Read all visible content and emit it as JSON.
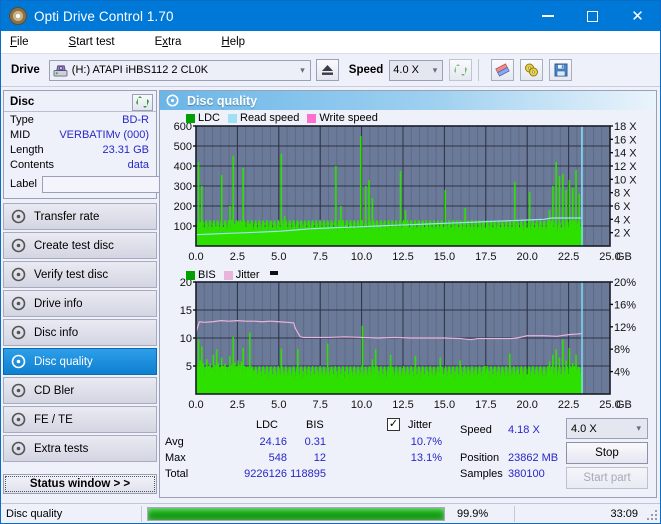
{
  "window": {
    "title": "Opti Drive Control 1.70",
    "icon": "disc-icon",
    "minimize": "−",
    "maximize": "□",
    "close": "✕"
  },
  "menu": [
    {
      "label": "File",
      "accel": "F"
    },
    {
      "label": "Start test",
      "accel": "S"
    },
    {
      "label": "Extra",
      "accel": "x"
    },
    {
      "label": "Help",
      "accel": "H"
    }
  ],
  "toolbar": {
    "drive_label": "Drive",
    "drive_value": "(H:) ATAPI iHBS112  2 CL0K",
    "eject_icon": "eject-icon",
    "speed_label": "Speed",
    "speed_value": "4.0 X",
    "refresh_icon": "refresh-icon",
    "erase_icon": "erase-icon",
    "disc-tools_icon": "disc-tools-icon",
    "save_icon": "save-icon"
  },
  "sidebar": {
    "disc_panel": {
      "title": "Disc",
      "refresh_icon": "refresh-green-icon",
      "rows": [
        {
          "key": "Type",
          "value": "BD-R"
        },
        {
          "key": "MID",
          "value": "VERBATIMv (000)"
        },
        {
          "key": "Length",
          "value": "23.31 GB"
        },
        {
          "key": "Contents",
          "value": "data"
        }
      ],
      "label_key": "Label",
      "label_value": "",
      "label_placeholder": "",
      "label_button_icon": "disc-yellow-icon"
    },
    "nav": [
      {
        "label": "Transfer rate",
        "icon": "disc-icon",
        "selected": false
      },
      {
        "label": "Create test disc",
        "icon": "disc-icon",
        "selected": false
      },
      {
        "label": "Verify test disc",
        "icon": "disc-icon",
        "selected": false
      },
      {
        "label": "Drive info",
        "icon": "disc-icon",
        "selected": false
      },
      {
        "label": "Disc info",
        "icon": "disc-icon",
        "selected": false
      },
      {
        "label": "Disc quality",
        "icon": "disc-icon",
        "selected": true
      },
      {
        "label": "CD Bler",
        "icon": "disc-icon",
        "selected": false
      },
      {
        "label": "FE / TE",
        "icon": "disc-icon",
        "selected": false
      },
      {
        "label": "Extra tests",
        "icon": "disc-icon",
        "selected": false
      }
    ],
    "status_window_button": "Status window > >"
  },
  "panel": {
    "title": "Disc quality",
    "icon": "disc-icon"
  },
  "stats": {
    "col_ldc": "LDC",
    "col_bis": "BIS",
    "jitter_label": "Jitter",
    "jitter_checked": true,
    "rows": [
      {
        "name": "Avg",
        "ldc": "24.16",
        "bis": "0.31",
        "jitter": "10.7%"
      },
      {
        "name": "Max",
        "ldc": "548",
        "bis": "12",
        "jitter": "13.1%"
      },
      {
        "name": "Total",
        "ldc": "9226126",
        "bis": "118895",
        "jitter": ""
      }
    ],
    "speed_key": "Speed",
    "speed_value": "4.18 X",
    "position_key": "Position",
    "position_value": "23862 MB",
    "samples_key": "Samples",
    "samples_value": "380100",
    "speed_select": "4.0 X",
    "stop_button": "Stop",
    "start_part_button": "Start part"
  },
  "statusbar": {
    "task": "Disc quality",
    "progress_percent": "99.9%",
    "progress_value": 99.9,
    "elapsed": "33:09"
  },
  "colors": {
    "accent": "#0078d7",
    "ldc_green": "#00a000",
    "bar_green": "#2ee000",
    "read_speed": "#9fe0f5",
    "write_speed": "#ff6fd0",
    "jitter_pink": "#e8b4dc",
    "plot_bg": "#6c7a99",
    "value_blue": "#2828c8"
  },
  "chart_data": [
    {
      "type": "bar",
      "name": "LDC / Read speed",
      "title": "",
      "xlabel": "GB",
      "ylabel": "LDC",
      "legend": [
        {
          "label": "LDC",
          "color": "#00a000"
        },
        {
          "label": "Read speed",
          "color": "#9fe0f5"
        },
        {
          "label": "Write speed",
          "color": "#ff6fd0"
        }
      ],
      "legend_position": "top-left",
      "grid": true,
      "xlim": [
        0.0,
        25.0
      ],
      "xticks": [
        "0.0",
        "2.5",
        "5.0",
        "7.5",
        "10.0",
        "12.5",
        "15.0",
        "17.5",
        "20.0",
        "22.5",
        "25.0"
      ],
      "ylim": [
        0,
        600
      ],
      "yticks": [
        100,
        200,
        300,
        400,
        500,
        600
      ],
      "y2lim": [
        0,
        18
      ],
      "y2ticks": [
        "2 X",
        "4 X",
        "6 X",
        "8 X",
        "10 X",
        "12 X",
        "14 X",
        "16 X",
        "18 X"
      ],
      "data_end_gb": 23.31,
      "series": [
        {
          "name": "LDC",
          "type": "bar",
          "color": "#2ee000",
          "x": [
            0.05,
            0.15,
            0.25,
            0.35,
            0.45,
            0.55,
            0.65,
            0.75,
            0.85,
            0.95,
            1.05,
            1.15,
            1.25,
            1.35,
            1.45,
            1.55,
            1.65,
            1.75,
            1.85,
            1.95,
            2.05,
            2.15,
            2.25,
            2.35,
            2.45,
            2.55,
            2.65,
            2.75,
            2.85,
            2.95,
            3.05,
            3.15,
            3.25,
            3.35,
            3.45,
            3.55,
            3.65,
            3.75,
            3.85,
            3.95,
            4.05,
            4.15,
            4.25,
            4.35,
            4.45,
            4.55,
            4.65,
            4.75,
            4.85,
            4.95,
            5.15,
            5.35,
            5.55,
            5.75,
            5.95,
            6.15,
            6.35,
            6.55,
            6.75,
            6.95,
            7.25,
            7.55,
            7.85,
            8.15,
            8.45,
            8.75,
            9.05,
            9.35,
            9.65,
            9.95,
            10.25,
            10.45,
            10.65,
            10.85,
            11.05,
            11.25,
            11.45,
            11.65,
            11.85,
            12.05,
            12.35,
            12.65,
            12.95,
            13.25,
            13.55,
            13.85,
            14.15,
            14.45,
            14.75,
            15.05,
            15.35,
            15.65,
            15.95,
            16.25,
            16.55,
            16.85,
            17.15,
            17.45,
            17.75,
            18.05,
            18.35,
            18.65,
            18.95,
            19.25,
            19.55,
            19.85,
            20.15,
            20.45,
            20.75,
            21.05,
            21.35,
            21.55,
            21.75,
            21.95,
            22.15,
            22.35,
            22.55,
            22.75,
            22.95,
            23.15
          ],
          "values": [
            60,
            420,
            120,
            300,
            90,
            70,
            110,
            75,
            80,
            70,
            95,
            100,
            85,
            75,
            80,
            355,
            95,
            90,
            85,
            70,
            200,
            130,
            450,
            110,
            95,
            125,
            100,
            120,
            390,
            105,
            95,
            85,
            110,
            90,
            75,
            70,
            65,
            60,
            55,
            50,
            60,
            55,
            50,
            45,
            50,
            45,
            40,
            45,
            40,
            35,
            460,
            150,
            40,
            35,
            30,
            120,
            35,
            30,
            25,
            30,
            25,
            20,
            30,
            25,
            400,
            200,
            25,
            30,
            25,
            550,
            300,
            330,
            240,
            30,
            25,
            20,
            25,
            20,
            25,
            20,
            375,
            180,
            25,
            30,
            25,
            30,
            25,
            20,
            25,
            280,
            30,
            25,
            20,
            190,
            25,
            30,
            25,
            20,
            25,
            30,
            25,
            20,
            25,
            320,
            25,
            20,
            270,
            25,
            20,
            25,
            180,
            300,
            420,
            350,
            360,
            280,
            330,
            290,
            380,
            260
          ]
        },
        {
          "name": "Read speed",
          "type": "line",
          "color": "#9fe0f5",
          "axis": "y2",
          "x": [
            0.0,
            1.0,
            2.0,
            3.0,
            4.0,
            5.0,
            6.0,
            7.0,
            8.0,
            9.0,
            10.0,
            11.0,
            12.0,
            13.0,
            14.0,
            15.0,
            16.0,
            17.0,
            18.0,
            19.0,
            20.0,
            21.0,
            21.5,
            22.0,
            23.0,
            23.3,
            23.3
          ],
          "values": [
            1.7,
            1.8,
            1.9,
            2.0,
            2.1,
            2.2,
            2.4,
            2.6,
            2.7,
            2.8,
            2.9,
            3.0,
            3.1,
            3.2,
            3.3,
            3.4,
            3.5,
            3.6,
            3.7,
            3.8,
            3.9,
            4.0,
            4.2,
            4.2,
            4.2,
            4.2,
            18.0
          ]
        }
      ]
    },
    {
      "type": "bar",
      "name": "BIS / Jitter",
      "title": "",
      "xlabel": "GB",
      "ylabel": "BIS",
      "legend": [
        {
          "label": "BIS",
          "color": "#00a000"
        },
        {
          "label": "Jitter",
          "color": "#e8b4dc"
        }
      ],
      "legend_position": "top-left",
      "grid": true,
      "xlim": [
        0.0,
        25.0
      ],
      "xticks": [
        "0.0",
        "2.5",
        "5.0",
        "7.5",
        "10.0",
        "12.5",
        "15.0",
        "17.5",
        "20.0",
        "22.5",
        "25.0"
      ],
      "ylim": [
        0,
        20
      ],
      "yticks": [
        5,
        10,
        15,
        20
      ],
      "y2lim": [
        0,
        20
      ],
      "y2ticks": [
        "4%",
        "8%",
        "12%",
        "16%",
        "20%"
      ],
      "data_end_gb": 23.31,
      "series": [
        {
          "name": "BIS",
          "type": "bar",
          "color": "#2ee000",
          "x": [
            0.05,
            0.15,
            0.25,
            0.35,
            0.45,
            0.55,
            0.65,
            0.75,
            0.85,
            0.95,
            1.05,
            1.15,
            1.25,
            1.35,
            1.45,
            1.55,
            1.65,
            1.75,
            1.85,
            1.95,
            2.05,
            2.15,
            2.25,
            2.35,
            2.45,
            2.55,
            2.65,
            2.75,
            2.85,
            2.95,
            3.05,
            3.15,
            3.25,
            3.35,
            3.45,
            3.55,
            3.65,
            3.75,
            3.85,
            3.95,
            4.05,
            4.15,
            4.25,
            4.35,
            4.45,
            4.55,
            4.65,
            4.75,
            4.85,
            4.95,
            5.15,
            5.35,
            5.55,
            5.75,
            5.95,
            6.15,
            6.45,
            6.75,
            7.05,
            7.35,
            7.65,
            7.95,
            8.25,
            8.55,
            8.85,
            9.15,
            9.45,
            9.75,
            10.05,
            10.35,
            10.65,
            10.85,
            11.05,
            11.25,
            11.45,
            11.75,
            12.05,
            12.35,
            12.65,
            12.95,
            13.25,
            13.55,
            13.85,
            14.15,
            14.45,
            14.75,
            15.05,
            15.35,
            15.65,
            15.95,
            16.25,
            16.55,
            16.85,
            17.15,
            17.45,
            17.75,
            18.05,
            18.35,
            18.65,
            18.95,
            19.25,
            19.55,
            19.85,
            20.15,
            20.45,
            20.75,
            21.05,
            21.35,
            21.55,
            21.75,
            21.95,
            22.15,
            22.35,
            22.55,
            22.75,
            22.95,
            23.15
          ],
          "values": [
            5.2,
            9.8,
            6.0,
            8.5,
            5.5,
            4.8,
            6.2,
            5.0,
            5.4,
            4.6,
            7.0,
            5.2,
            8.0,
            5.5,
            4.8,
            6.5,
            5.0,
            5.4,
            4.8,
            4.4,
            6.8,
            5.2,
            10.2,
            5.6,
            4.8,
            6.0,
            5.2,
            5.8,
            8.2,
            5.0,
            4.8,
            4.4,
            11.0,
            4.6,
            4.2,
            3.8,
            3.6,
            3.4,
            3.2,
            3.0,
            3.4,
            3.2,
            3.0,
            2.8,
            3.0,
            2.8,
            2.6,
            2.8,
            2.6,
            2.4,
            8.1,
            3.0,
            2.6,
            2.4,
            2.2,
            8.0,
            2.2,
            2.0,
            2.2,
            2.0,
            1.9,
            9.0,
            2.0,
            1.9,
            2.0,
            1.9,
            2.0,
            1.9,
            12.2,
            2.0,
            6.2,
            8.0,
            2.0,
            1.9,
            2.0,
            7.0,
            2.0,
            1.9,
            2.0,
            1.9,
            6.8,
            2.0,
            1.9,
            2.0,
            1.9,
            6.5,
            2.0,
            1.9,
            2.0,
            6.0,
            1.9,
            2.0,
            1.9,
            2.0,
            5.0,
            1.9,
            2.0,
            1.9,
            2.0,
            7.2,
            1.9,
            2.0,
            1.9,
            2.0,
            1.9,
            2.0,
            1.9,
            5.8,
            7.0,
            8.0,
            6.5,
            9.7,
            6.0,
            8.2,
            5.5,
            7.0,
            4.8
          ]
        },
        {
          "name": "Jitter",
          "type": "line",
          "color": "#e8b4dc",
          "axis": "y2",
          "x": [
            0.0,
            0.2,
            0.5,
            1.0,
            1.5,
            2.0,
            2.5,
            3.0,
            3.5,
            4.0,
            4.5,
            5.0,
            5.5,
            5.9,
            6.0,
            6.3,
            6.5,
            7.0,
            8.0,
            9.0,
            10.0,
            11.0,
            12.0,
            13.0,
            14.0,
            15.0,
            16.0,
            16.6,
            17.0,
            18.0,
            19.0,
            19.4,
            20.0,
            21.0,
            21.8,
            22.5,
            23.0,
            23.3
          ],
          "values": [
            11.0,
            12.9,
            12.8,
            12.9,
            13.1,
            13.0,
            13.1,
            13.0,
            13.0,
            12.9,
            13.0,
            12.9,
            12.8,
            12.7,
            11.7,
            10.2,
            10.1,
            10.1,
            10.1,
            10.2,
            10.1,
            10.0,
            10.1,
            10.0,
            10.0,
            10.0,
            9.9,
            9.7,
            9.9,
            9.9,
            9.9,
            10.0,
            10.4,
            10.4,
            10.3,
            10.6,
            10.7,
            10.8
          ]
        }
      ]
    }
  ]
}
